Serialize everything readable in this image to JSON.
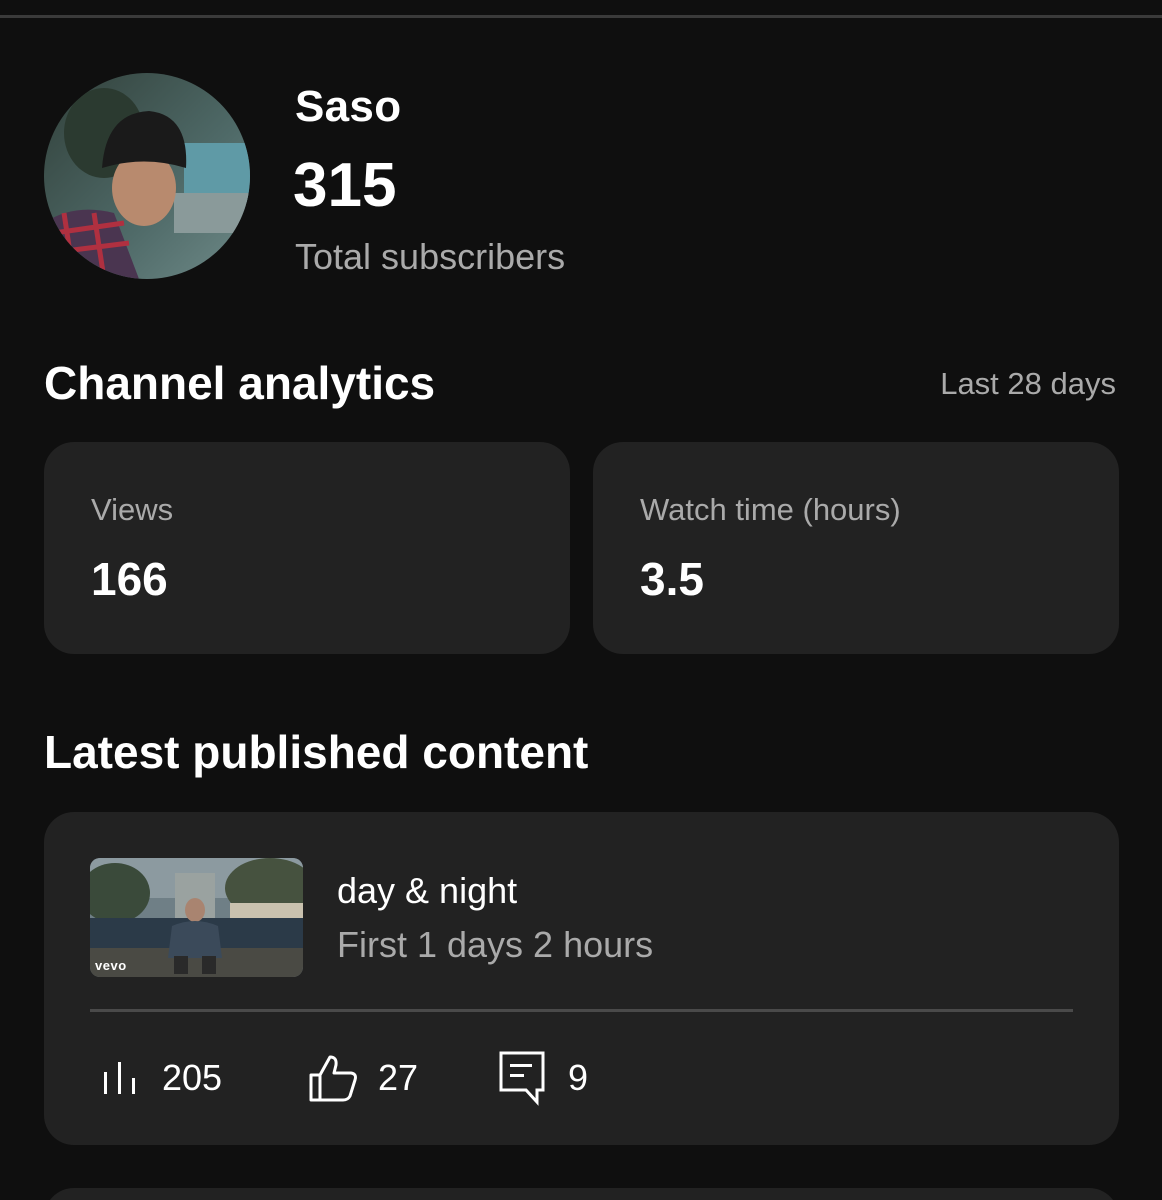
{
  "channel": {
    "name": "Saso",
    "subscriber_count": "315",
    "subscriber_label": "Total subscribers"
  },
  "analytics": {
    "title": "Channel analytics",
    "range": "Last 28 days",
    "cards": [
      {
        "label": "Views",
        "value": "166"
      },
      {
        "label": "Watch time (hours)",
        "value": "3.5"
      }
    ]
  },
  "latest": {
    "title": "Latest published content",
    "video": {
      "title": "day & night",
      "subtitle": "First 1 days 2 hours",
      "thumbnail_badge": "vevo",
      "metrics": {
        "views": "205",
        "likes": "27",
        "comments": "9"
      },
      "icons": [
        "bar-chart-icon",
        "thumbs-up-icon",
        "comment-icon"
      ]
    }
  },
  "colors": {
    "background": "#0f0f0f",
    "card": "#222222",
    "text_primary": "#ffffff",
    "text_secondary": "#aaaaaa"
  }
}
